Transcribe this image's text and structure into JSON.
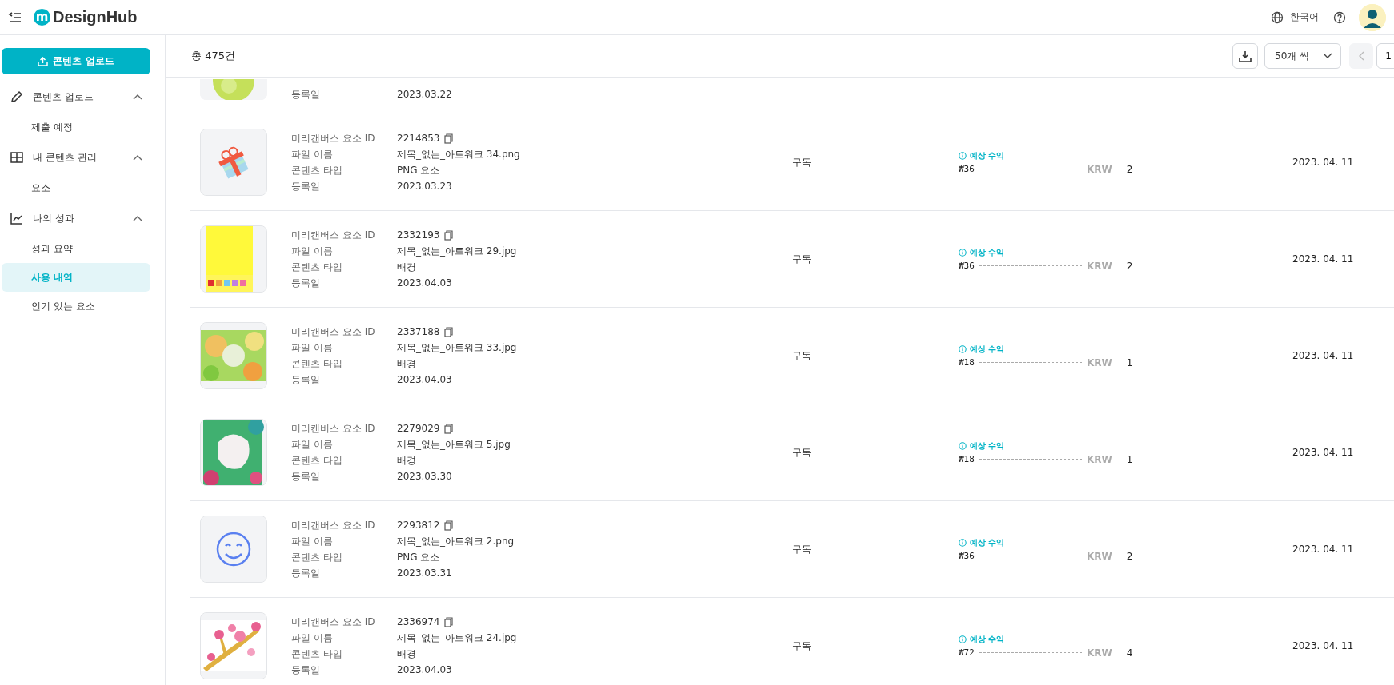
{
  "header": {
    "logo_mark": "m",
    "logo": "DesignHub",
    "language": "한국어"
  },
  "sidebar": {
    "upload_button": "콘텐츠 업로드",
    "sections": [
      {
        "label": "콘텐츠 업로드",
        "expanded": true,
        "children": [
          {
            "label": "제출 예정",
            "selected": false
          }
        ]
      },
      {
        "label": "내 콘텐츠 관리",
        "expanded": true,
        "children": [
          {
            "label": "요소",
            "selected": false
          }
        ]
      },
      {
        "label": "나의 성과",
        "expanded": true,
        "children": [
          {
            "label": "성과 요약",
            "selected": false
          },
          {
            "label": "사용 내역",
            "selected": true
          },
          {
            "label": "인기 있는 요소",
            "selected": false
          }
        ]
      }
    ]
  },
  "toolbar": {
    "total": "총 475건",
    "page_size": "50개 씩",
    "page": "1"
  },
  "rows": [
    {
      "kind": "partial",
      "fields": [
        {
          "kind": "text",
          "label": "등록일",
          "value": "2023.03.22"
        }
      ]
    },
    {
      "kind": "full",
      "fields": [
        {
          "kind": "id",
          "label": "미리캔버스 요소 ID",
          "value": "2214853"
        },
        {
          "kind": "text",
          "label": "파일 이름",
          "value": "제목_없는_아트워크 34.png"
        },
        {
          "kind": "text",
          "label": "콘텐츠 타입",
          "value": "PNG 요소"
        },
        {
          "kind": "text",
          "label": "등록일",
          "value": "2023.03.23"
        }
      ],
      "plan": "구독",
      "revenue_label": "예상 수익",
      "amount": "₩36",
      "currency": "KRW",
      "count": "2",
      "date": "2023. 04. 11"
    },
    {
      "kind": "full",
      "fields": [
        {
          "kind": "id",
          "label": "미리캔버스 요소 ID",
          "value": "2332193"
        },
        {
          "kind": "text",
          "label": "파일 이름",
          "value": "제목_없는_아트워크 29.jpg"
        },
        {
          "kind": "text",
          "label": "콘텐츠 타입",
          "value": "배경"
        },
        {
          "kind": "text",
          "label": "등록일",
          "value": "2023.04.03"
        }
      ],
      "plan": "구독",
      "revenue_label": "예상 수익",
      "amount": "₩36",
      "currency": "KRW",
      "count": "2",
      "date": "2023. 04. 11"
    },
    {
      "kind": "full",
      "fields": [
        {
          "kind": "id",
          "label": "미리캔버스 요소 ID",
          "value": "2337188"
        },
        {
          "kind": "text",
          "label": "파일 이름",
          "value": "제목_없는_아트워크 33.jpg"
        },
        {
          "kind": "text",
          "label": "콘텐츠 타입",
          "value": "배경"
        },
        {
          "kind": "text",
          "label": "등록일",
          "value": "2023.04.03"
        }
      ],
      "plan": "구독",
      "revenue_label": "예상 수익",
      "amount": "₩18",
      "currency": "KRW",
      "count": "1",
      "date": "2023. 04. 11"
    },
    {
      "kind": "full",
      "fields": [
        {
          "kind": "id",
          "label": "미리캔버스 요소 ID",
          "value": "2279029"
        },
        {
          "kind": "text",
          "label": "파일 이름",
          "value": "제목_없는_아트워크 5.jpg"
        },
        {
          "kind": "text",
          "label": "콘텐츠 타입",
          "value": "배경"
        },
        {
          "kind": "text",
          "label": "등록일",
          "value": "2023.03.30"
        }
      ],
      "plan": "구독",
      "revenue_label": "예상 수익",
      "amount": "₩18",
      "currency": "KRW",
      "count": "1",
      "date": "2023. 04. 11"
    },
    {
      "kind": "full",
      "fields": [
        {
          "kind": "id",
          "label": "미리캔버스 요소 ID",
          "value": "2293812"
        },
        {
          "kind": "text",
          "label": "파일 이름",
          "value": "제목_없는_아트워크 2.png"
        },
        {
          "kind": "text",
          "label": "콘텐츠 타입",
          "value": "PNG 요소"
        },
        {
          "kind": "text",
          "label": "등록일",
          "value": "2023.03.31"
        }
      ],
      "plan": "구독",
      "revenue_label": "예상 수익",
      "amount": "₩36",
      "currency": "KRW",
      "count": "2",
      "date": "2023. 04. 11"
    },
    {
      "kind": "full",
      "fields": [
        {
          "kind": "id",
          "label": "미리캔버스 요소 ID",
          "value": "2336974"
        },
        {
          "kind": "text",
          "label": "파일 이름",
          "value": "제목_없는_아트워크 24.jpg"
        },
        {
          "kind": "text",
          "label": "콘텐츠 타입",
          "value": "배경"
        },
        {
          "kind": "text",
          "label": "등록일",
          "value": "2023.04.03"
        }
      ],
      "plan": "구독",
      "revenue_label": "예상 수익",
      "amount": "₩72",
      "currency": "KRW",
      "count": "4",
      "date": "2023. 04. 11"
    }
  ]
}
